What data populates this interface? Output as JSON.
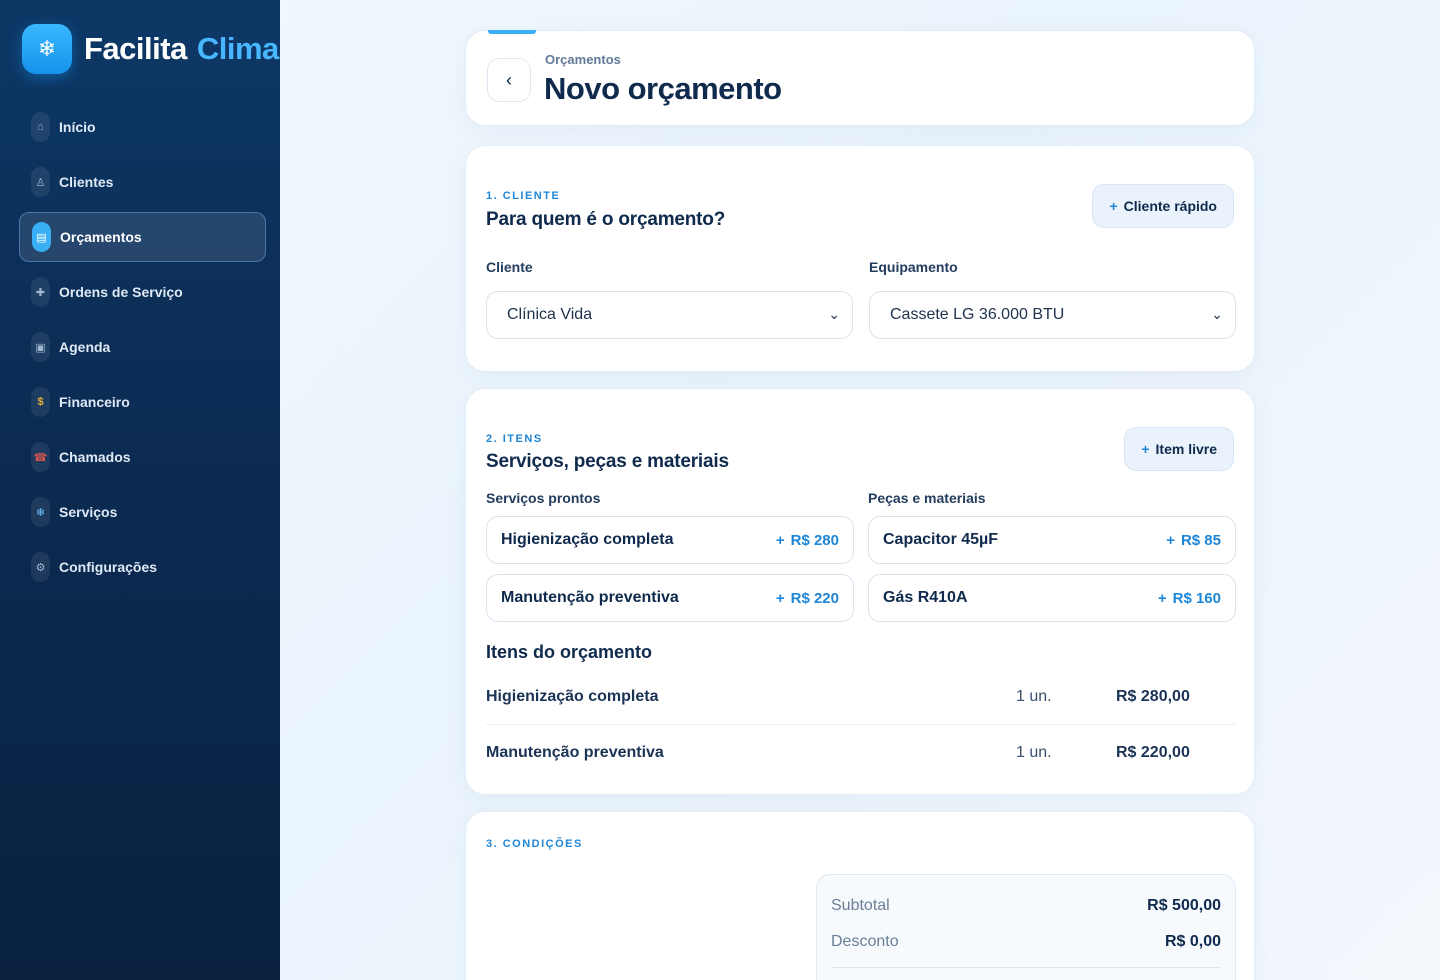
{
  "brand": {
    "icon": "snowflake-icon",
    "name_a": "Facilita",
    "name_b": "Clima"
  },
  "nav": [
    {
      "label": "Início",
      "icon": "home-icon",
      "glyph": "⌂",
      "active": false
    },
    {
      "label": "Clientes",
      "icon": "user-icon",
      "glyph": "♙",
      "active": false
    },
    {
      "label": "Orçamentos",
      "icon": "receipt-icon",
      "glyph": "▤",
      "active": true
    },
    {
      "label": "Ordens de Serviço",
      "icon": "tools-icon",
      "glyph": "✚",
      "active": false
    },
    {
      "label": "Agenda",
      "icon": "calendar-icon",
      "glyph": "▣",
      "active": false
    },
    {
      "label": "Financeiro",
      "icon": "money-bag-icon",
      "glyph": "$",
      "active": false
    },
    {
      "label": "Chamados",
      "icon": "phone-icon",
      "glyph": "☎",
      "active": false
    },
    {
      "label": "Serviços",
      "icon": "snowflake-icon",
      "glyph": "❄",
      "active": false
    },
    {
      "label": "Configurações",
      "icon": "gear-icon",
      "glyph": "⚙",
      "active": false
    }
  ],
  "header": {
    "breadcrumb": "Orçamentos",
    "title": "Novo orçamento",
    "back_glyph": "‹"
  },
  "section1": {
    "label": "1. CLIENTE",
    "title": "Para quem é o orçamento?",
    "quick_client": "Cliente rápido",
    "client_label": "Cliente",
    "client_value": "Clínica Vida",
    "equipment_label": "Equipamento",
    "equipment_value": "Cassete LG 36.000 BTU"
  },
  "section2": {
    "label": "2. ITENS",
    "title": "Serviços, peças e materiais",
    "free_item": "Item livre",
    "services_label": "Serviços prontos",
    "parts_label": "Peças e materiais",
    "services": [
      {
        "name": "Higienização completa",
        "price": "R$ 280"
      },
      {
        "name": "Manutenção preventiva",
        "price": "R$ 220"
      }
    ],
    "parts": [
      {
        "name": "Capacitor 45µF",
        "price": "R$ 85"
      },
      {
        "name": "Gás R410A",
        "price": "R$ 160"
      }
    ],
    "items_title": "Itens do orçamento",
    "items": [
      {
        "name": "Higienização completa",
        "qty": "1 un.",
        "value": "R$ 280,00"
      },
      {
        "name": "Manutenção preventiva",
        "qty": "1 un.",
        "value": "R$ 220,00"
      }
    ]
  },
  "section3": {
    "label": "3. CONDIÇÕES",
    "subtotal_label": "Subtotal",
    "subtotal_value": "R$ 500,00",
    "discount_label": "Desconto",
    "discount_value": "R$ 0,00"
  },
  "plus_glyph": "+",
  "chevron_glyph": "⌄",
  "colors": {
    "accent": "#1e86d6",
    "sidebar": "#0b2c54",
    "brand_blue": "#47b6ff"
  }
}
